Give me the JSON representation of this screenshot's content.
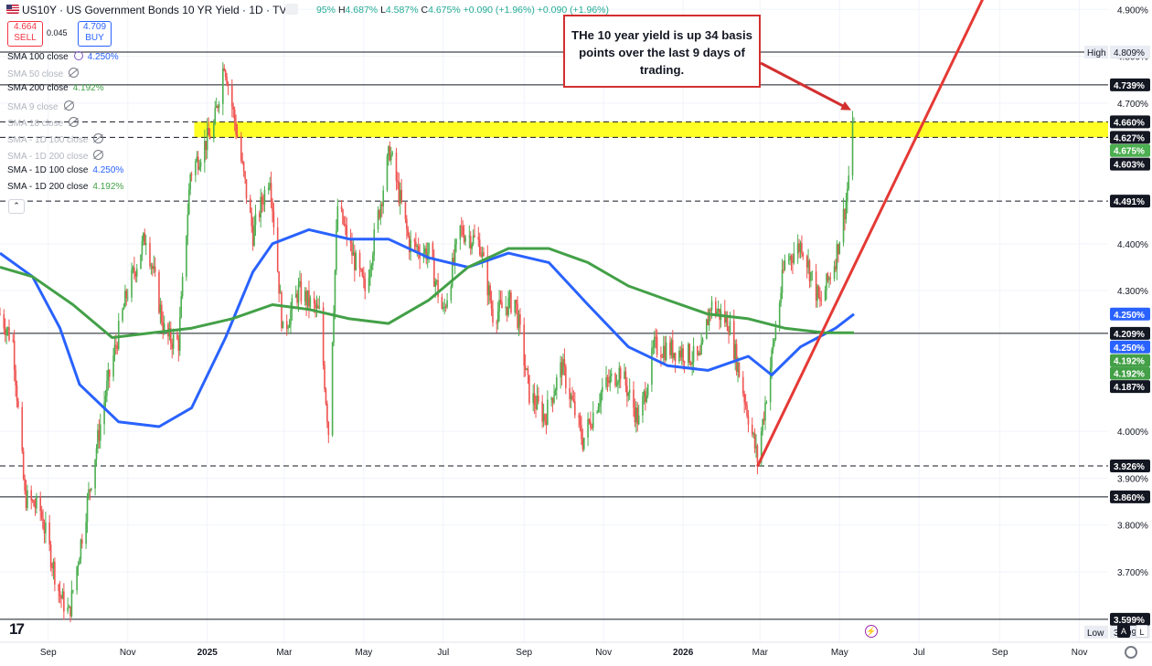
{
  "header": {
    "title": "US10Y · US Government Bonds 10 YR Yield · 1D · TVC",
    "ohlc_open": "95%",
    "ohlc_high_label": "H",
    "ohlc_high": "4.687%",
    "ohlc_low_label": "L",
    "ohlc_low": "4.587%",
    "ohlc_close_label": "C",
    "ohlc_close": "4.675%",
    "change": "+0.090 (+1.96%)",
    "change2": "+0.090 (+1.96%)"
  },
  "trade": {
    "sell_price": "4.664",
    "sell_label": "SELL",
    "spread": "0.045",
    "buy_price": "4.709",
    "buy_label": "BUY"
  },
  "indicators": [
    {
      "label": "SMA 100 close",
      "value": "4.250%",
      "color": "#2962ff",
      "dim": false,
      "icon": "loop-icon"
    },
    {
      "label": "SMA 50 close",
      "value": "",
      "color": "",
      "dim": true,
      "icon": "eye-off-icon"
    },
    {
      "label": "SMA 200 close",
      "value": "4.192%",
      "color": "#43a047",
      "dim": false,
      "icon": ""
    },
    {
      "label": "SMA 9 close",
      "value": "",
      "color": "",
      "dim": true,
      "icon": "eye-off-icon"
    },
    {
      "label": "SMA 18 close",
      "value": "",
      "color": "",
      "dim": true,
      "icon": "eye-off-icon"
    },
    {
      "label": "SMA - 1D 100 close",
      "value": "",
      "color": "",
      "dim": true,
      "icon": "eye-off-icon"
    },
    {
      "label": "SMA - 1D 200 close",
      "value": "",
      "color": "",
      "dim": true,
      "icon": "eye-off-icon"
    },
    {
      "label": "SMA - 1D 100 close",
      "value": "4.250%",
      "color": "#2962ff",
      "dim": false,
      "icon": ""
    },
    {
      "label": "SMA - 1D 200 close",
      "value": "4.192%",
      "color": "#43a047",
      "dim": false,
      "icon": ""
    }
  ],
  "collapse_icon": "chevron-up-icon",
  "annotation": "THe 10 year yield is up 34 basis points over the last 9 days of trading.",
  "logo_text": "17",
  "controls": {
    "auto": "A",
    "log": "L"
  },
  "chart_data": {
    "type": "candlestick",
    "title": "US Government Bonds 10 YR Yield",
    "y_range": [
      3.55,
      4.92
    ],
    "x_range": [
      "2024-07-26",
      "2026-11-23"
    ],
    "y_ticks": [
      "4.900%",
      "4.800%",
      "4.700%",
      "4.400%",
      "4.300%",
      "4.000%",
      "3.900%",
      "3.800%",
      "3.700%"
    ],
    "y_tick_values": [
      4.9,
      4.8,
      4.7,
      4.4,
      4.3,
      4.0,
      3.9,
      3.8,
      3.7
    ],
    "x_ticks": [
      "Sep",
      "Nov",
      "2025",
      "Mar",
      "May",
      "Jul",
      "Sep",
      "Nov",
      "2026",
      "Mar",
      "May",
      "Jul",
      "Sep",
      "Nov"
    ],
    "x_tick_dates": [
      "2024-09-01",
      "2024-11-01",
      "2025-01-01",
      "2025-03-01",
      "2025-05-01",
      "2025-07-01",
      "2025-09-01",
      "2025-11-01",
      "2026-01-01",
      "2026-03-01",
      "2026-05-01",
      "2026-07-01",
      "2026-09-01",
      "2026-11-01"
    ],
    "price_path": [
      [
        "2024-07-26",
        4.25
      ],
      [
        "2024-08-05",
        4.19
      ],
      [
        "2024-08-14",
        3.86
      ],
      [
        "2024-08-26",
        3.83
      ],
      [
        "2024-09-10",
        3.65
      ],
      [
        "2024-09-17",
        3.61
      ],
      [
        "2024-09-27",
        3.78
      ],
      [
        "2024-10-07",
        3.95
      ],
      [
        "2024-10-15",
        4.08
      ],
      [
        "2024-10-31",
        4.29
      ],
      [
        "2024-11-15",
        4.42
      ],
      [
        "2024-11-30",
        4.2
      ],
      [
        "2024-12-10",
        4.19
      ],
      [
        "2024-12-19",
        4.55
      ],
      [
        "2025-01-06",
        4.65
      ],
      [
        "2025-01-14",
        4.79
      ],
      [
        "2025-01-24",
        4.63
      ],
      [
        "2025-02-05",
        4.42
      ],
      [
        "2025-02-18",
        4.55
      ],
      [
        "2025-02-28",
        4.21
      ],
      [
        "2025-03-12",
        4.3
      ],
      [
        "2025-03-28",
        4.25
      ],
      [
        "2025-04-04",
        4.0
      ],
      [
        "2025-04-11",
        4.48
      ],
      [
        "2025-04-22",
        4.38
      ],
      [
        "2025-05-02",
        4.3
      ],
      [
        "2025-05-21",
        4.6
      ],
      [
        "2025-06-05",
        4.4
      ],
      [
        "2025-06-20",
        4.38
      ],
      [
        "2025-07-01",
        4.25
      ],
      [
        "2025-07-14",
        4.43
      ],
      [
        "2025-07-29",
        4.4
      ],
      [
        "2025-08-08",
        4.25
      ],
      [
        "2025-08-25",
        4.28
      ],
      [
        "2025-09-05",
        4.08
      ],
      [
        "2025-09-17",
        4.03
      ],
      [
        "2025-09-30",
        4.14
      ],
      [
        "2025-10-16",
        3.98
      ],
      [
        "2025-10-31",
        4.09
      ],
      [
        "2025-11-14",
        4.13
      ],
      [
        "2025-11-28",
        4.02
      ],
      [
        "2025-12-10",
        4.18
      ],
      [
        "2025-12-31",
        4.17
      ],
      [
        "2026-01-14",
        4.15
      ],
      [
        "2026-01-22",
        4.27
      ],
      [
        "2026-02-05",
        4.23
      ],
      [
        "2026-02-18",
        4.06
      ],
      [
        "2026-02-27",
        3.94
      ],
      [
        "2026-03-10",
        4.16
      ],
      [
        "2026-03-20",
        4.36
      ],
      [
        "2026-04-02",
        4.4
      ],
      [
        "2026-04-16",
        4.27
      ],
      [
        "2026-04-28",
        4.37
      ],
      [
        "2026-05-06",
        4.49
      ],
      [
        "2026-05-10",
        4.6
      ],
      [
        "2026-05-12",
        4.675
      ]
    ],
    "series": [
      {
        "name": "SMA 100 close",
        "color": "#2962ff",
        "points": [
          [
            "2024-07-26",
            4.38
          ],
          [
            "2024-08-20",
            4.33
          ],
          [
            "2024-09-10",
            4.22
          ],
          [
            "2024-09-25",
            4.1
          ],
          [
            "2024-10-25",
            4.02
          ],
          [
            "2024-11-25",
            4.01
          ],
          [
            "2024-12-20",
            4.05
          ],
          [
            "2025-01-15",
            4.2
          ],
          [
            "2025-02-05",
            4.34
          ],
          [
            "2025-02-20",
            4.4
          ],
          [
            "2025-03-20",
            4.43
          ],
          [
            "2025-04-20",
            4.41
          ],
          [
            "2025-05-20",
            4.41
          ],
          [
            "2025-06-20",
            4.37
          ],
          [
            "2025-07-20",
            4.35
          ],
          [
            "2025-08-20",
            4.38
          ],
          [
            "2025-09-20",
            4.36
          ],
          [
            "2025-10-20",
            4.27
          ],
          [
            "2025-11-20",
            4.18
          ],
          [
            "2025-12-20",
            4.14
          ],
          [
            "2026-01-20",
            4.13
          ],
          [
            "2026-02-20",
            4.16
          ],
          [
            "2026-03-10",
            4.12
          ],
          [
            "2026-04-01",
            4.18
          ],
          [
            "2026-04-28",
            4.22
          ],
          [
            "2026-05-12",
            4.25
          ]
        ]
      },
      {
        "name": "SMA 200 close",
        "color": "#43a047",
        "points": [
          [
            "2024-07-26",
            4.35
          ],
          [
            "2024-08-20",
            4.33
          ],
          [
            "2024-09-20",
            4.27
          ],
          [
            "2024-10-20",
            4.2
          ],
          [
            "2024-11-20",
            4.21
          ],
          [
            "2024-12-20",
            4.22
          ],
          [
            "2025-01-20",
            4.24
          ],
          [
            "2025-02-20",
            4.27
          ],
          [
            "2025-03-20",
            4.26
          ],
          [
            "2025-04-20",
            4.24
          ],
          [
            "2025-05-20",
            4.23
          ],
          [
            "2025-06-20",
            4.28
          ],
          [
            "2025-07-20",
            4.35
          ],
          [
            "2025-08-20",
            4.39
          ],
          [
            "2025-09-20",
            4.39
          ],
          [
            "2025-10-20",
            4.36
          ],
          [
            "2025-11-20",
            4.31
          ],
          [
            "2025-12-20",
            4.28
          ],
          [
            "2026-01-20",
            4.25
          ],
          [
            "2026-02-20",
            4.24
          ],
          [
            "2026-03-20",
            4.22
          ],
          [
            "2026-04-20",
            4.21
          ],
          [
            "2026-05-12",
            4.21
          ]
        ]
      }
    ],
    "zone": {
      "from": 4.627,
      "to": 4.66,
      "color": "#ffff00",
      "start": "2024-12-22"
    },
    "levels": [
      {
        "value": 4.809,
        "style": "solid",
        "tag": "4.809%",
        "tag_color": "#131722"
      },
      {
        "value": 4.739,
        "style": "solid",
        "tag": "4.739%",
        "tag_color": "#131722"
      },
      {
        "value": 4.66,
        "style": "dashed",
        "tag": "4.660%",
        "tag_color": "#131722"
      },
      {
        "value": 4.627,
        "style": "dashed",
        "tag": "4.627%",
        "tag_color": "#131722"
      },
      {
        "value": 4.491,
        "style": "dashed",
        "tag": "4.491%",
        "tag_color": "#131722"
      },
      {
        "value": 4.209,
        "style": "solid",
        "tag": "4.209%",
        "tag_color": "#131722"
      },
      {
        "value": 3.926,
        "style": "dashed",
        "tag": "3.926%",
        "tag_color": "#131722"
      },
      {
        "value": 3.86,
        "style": "solid",
        "tag": "3.860%",
        "tag_color": "#131722"
      },
      {
        "value": 3.599,
        "style": "solid",
        "tag": "3.599%",
        "tag_color": "#131722"
      }
    ],
    "price_tags": [
      {
        "value": 4.675,
        "text": "4.675%",
        "color": "#4caf50"
      },
      {
        "value": 4.603,
        "text": "4.603%",
        "color": "#131722"
      },
      {
        "value": 4.25,
        "text": "4.250%",
        "color": "#2962ff"
      },
      {
        "value": 4.25,
        "text": "4.250%",
        "color": "#2962ff"
      },
      {
        "value": 4.192,
        "text": "4.192%",
        "color": "#43a047"
      },
      {
        "value": 4.192,
        "text": "4.192%",
        "color": "#43a047"
      },
      {
        "value": 4.187,
        "text": "4.187%",
        "color": "#131722"
      }
    ],
    "high_label": "High",
    "high_value": "4.809%",
    "low_label": "Low",
    "low_value": "3.599%",
    "trendline": {
      "from": [
        "2026-02-27",
        3.925
      ],
      "to": [
        "2026-09-10",
        5.05
      ],
      "color": "#e53935"
    },
    "arrow": {
      "to": [
        "2026-05-10",
        4.685
      ],
      "color": "#d32f2f"
    }
  }
}
